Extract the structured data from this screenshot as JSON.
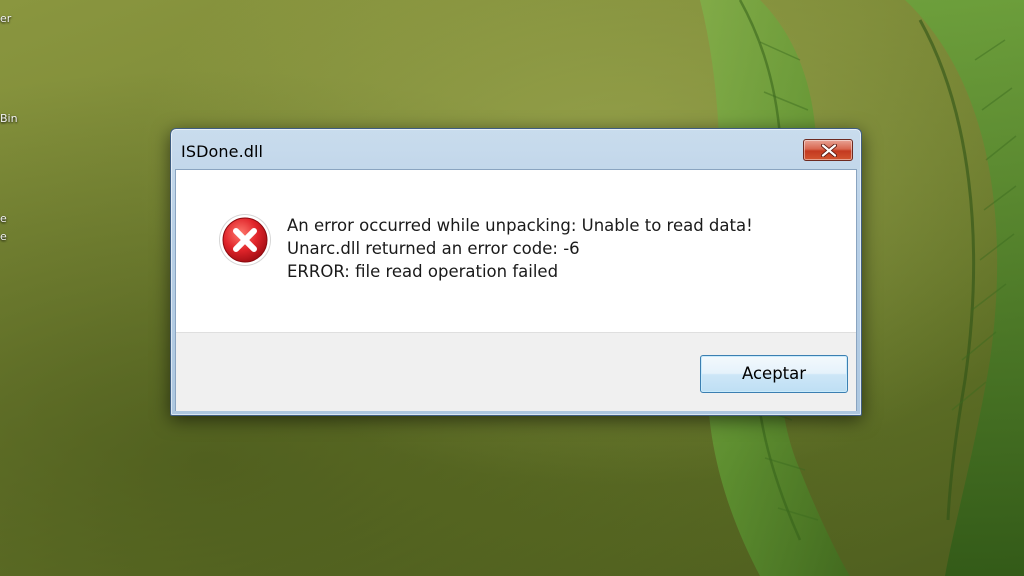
{
  "desktop": {
    "icon_labels": [
      "er",
      "Bin",
      "e",
      "e"
    ]
  },
  "dialog": {
    "title": "ISDone.dll",
    "close_symbol": "close-icon",
    "icon": "error-icon",
    "message_lines": [
      "An error occurred while unpacking: Unable to read data!",
      "Unarc.dll returned an error code: -6",
      "ERROR: file read operation failed"
    ],
    "ok_label": "Aceptar"
  },
  "colors": {
    "error_red": "#d9141b",
    "close_button_red": "#c43a1f",
    "button_border_blue": "#3c7fb1",
    "title_bar_blue": "#b7cfe6"
  }
}
